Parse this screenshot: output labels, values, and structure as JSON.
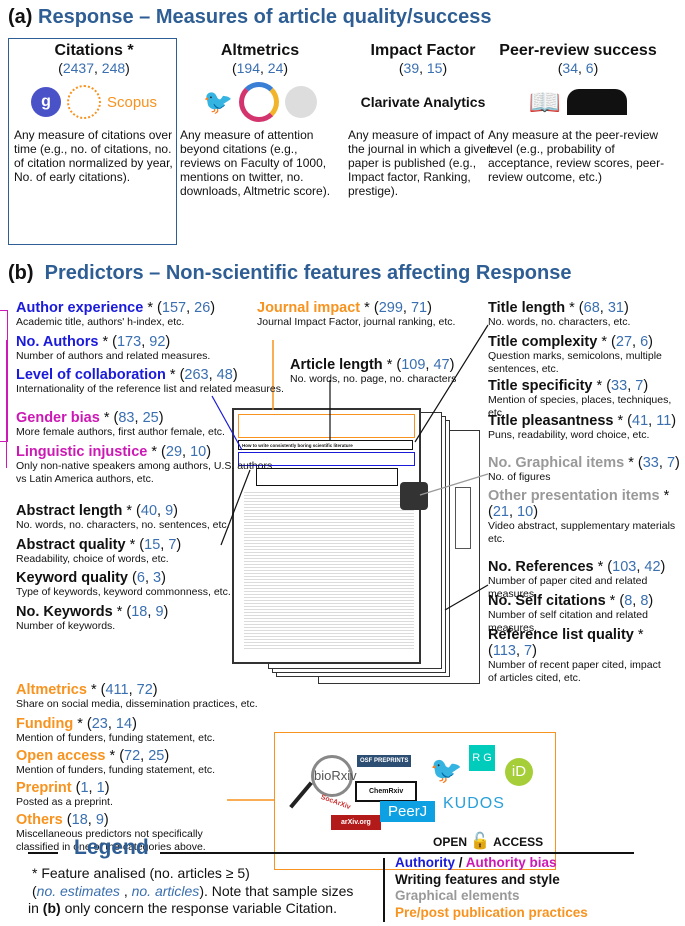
{
  "section_a": {
    "label": "(a)",
    "title": "Response – Measures of article quality/success"
  },
  "responses": [
    {
      "title": "Citations *",
      "estimates": "2437",
      "articles": "248",
      "desc": "Any measure of citations over time (e.g., no. of citations, no. of citation normalized by year, No. of early citations).",
      "logos": [
        "google-scholar",
        "web-of-science",
        "Scopus"
      ]
    },
    {
      "title": "Altmetrics",
      "estimates": "194",
      "articles": "24",
      "desc": "Any measure of attention beyond citations (e.g., reviews on Faculty of 1000, mentions on twitter, no. downloads, Altmetric score).",
      "logos": [
        "twitter",
        "altmetric-1475",
        "wikipedia"
      ]
    },
    {
      "title": "Impact Factor",
      "estimates": "39",
      "articles": "15",
      "desc": "Any measure of impact of the journal in which a given paper is published (e.g., Impact factor, Ranking, prestige).",
      "logos": [
        "Clarivate Analytics"
      ]
    },
    {
      "title": "Peer-review success",
      "estimates": "34",
      "articles": "6",
      "desc": "Any measure at the peer-review level (e.g., probability of acceptance, review scores, peer-review outcome, etc.)",
      "logos": [
        "book",
        "people"
      ]
    }
  ],
  "section_b": {
    "label": "(b)",
    "title": "Predictors – Non-scientific features affecting Response"
  },
  "colors": {
    "authority": "#1a1adb",
    "authority_bias": "#cc18b4",
    "writing": "#111111",
    "graphical": "#999999",
    "practices": "#f7931e",
    "numbers": "#3a6fb0"
  },
  "predictors": [
    {
      "name": "Author experience",
      "star": "*",
      "estimates": "157",
      "articles": "26",
      "desc": "Academic title, authors' h-index, etc.",
      "cat": "authority"
    },
    {
      "name": "No. Authors",
      "star": "*",
      "estimates": "173",
      "articles": "92",
      "desc": "Number of authors and related measures.",
      "cat": "authority"
    },
    {
      "name": "Level of collaboration",
      "star": "*",
      "estimates": "263",
      "articles": "48",
      "desc": "Internationality of the reference list and related measures.",
      "cat": "authority"
    },
    {
      "name": "Gender bias",
      "star": "*",
      "estimates": "83",
      "articles": "25",
      "desc": "More female authors, first author female, etc.",
      "cat": "authority_bias"
    },
    {
      "name": "Linguistic injustice",
      "star": "*",
      "estimates": "29",
      "articles": "10",
      "desc": "Only non-native speakers among authors, U.S. authors vs Latin America authors, etc.",
      "cat": "authority_bias"
    },
    {
      "name": "Abstract length",
      "star": "*",
      "estimates": "40",
      "articles": "9",
      "desc": "No. words, no. characters, no. sentences, etc.",
      "cat": "writing"
    },
    {
      "name": "Abstract quality",
      "star": "*",
      "estimates": "15",
      "articles": "7",
      "desc": "Readability, choice of words, etc.",
      "cat": "writing"
    },
    {
      "name": "Keyword quality",
      "star": "",
      "estimates": "6",
      "articles": "3",
      "desc": "Type of keywords, keyword commonness, etc.",
      "cat": "writing"
    },
    {
      "name": "No. Keywords",
      "star": "*",
      "estimates": "18",
      "articles": "9",
      "desc": "Number of keywords.",
      "cat": "writing"
    },
    {
      "name": "Altmetrics",
      "star": "*",
      "estimates": "411",
      "articles": "72",
      "desc": "Share on social media, dissemination practices, etc.",
      "cat": "practices"
    },
    {
      "name": "Funding",
      "star": "*",
      "estimates": "23",
      "articles": "14",
      "desc": "Mention of funders, funding statement, etc.",
      "cat": "practices"
    },
    {
      "name": "Open access",
      "star": "*",
      "estimates": "72",
      "articles": "25",
      "desc": "Mention of funders, funding statement, etc.",
      "cat": "practices"
    },
    {
      "name": "Preprint",
      "star": "",
      "estimates": "1",
      "articles": "1",
      "desc": "Posted as a preprint.",
      "cat": "practices"
    },
    {
      "name": "Others",
      "star": "",
      "estimates": "18",
      "articles": "9",
      "desc": "Miscellaneous predictors not specifically classified in one of the categories above.",
      "cat": "practices"
    },
    {
      "name": "Journal impact",
      "star": "*",
      "estimates": "299",
      "articles": "71",
      "desc": "Journal Impact Factor, journal ranking, etc.",
      "cat": "practices"
    },
    {
      "name": "Article length",
      "star": "*",
      "estimates": "109",
      "articles": "47",
      "desc": "No. words, no. page, no. characters",
      "cat": "writing"
    },
    {
      "name": "Title length",
      "star": "*",
      "estimates": "68",
      "articles": "31",
      "desc": "No. words, no. characters,  etc.",
      "cat": "writing"
    },
    {
      "name": "Title complexity",
      "star": "*",
      "estimates": "27",
      "articles": "6",
      "desc": "Question marks, semicolons, multiple sentences, etc.",
      "cat": "writing"
    },
    {
      "name": "Title specificity",
      "star": "*",
      "estimates": "33",
      "articles": "7",
      "desc": "Mention of species, places, techniques, etc.",
      "cat": "writing"
    },
    {
      "name": "Title pleasantness",
      "star": "*",
      "estimates": "41",
      "articles": "11",
      "desc": "Puns, readability, word choice, etc.",
      "cat": "writing"
    },
    {
      "name": "No. Graphical items",
      "star": "*",
      "estimates": "33",
      "articles": "7",
      "desc": "No. of figures",
      "cat": "graphical"
    },
    {
      "name": "Other presentation items",
      "star": "*",
      "estimates": "21",
      "articles": "10",
      "desc": "Video abstract, supplementary materials etc.",
      "cat": "graphical"
    },
    {
      "name": "No. References",
      "star": "*",
      "estimates": "103",
      "articles": "42",
      "desc": "Number of paper cited and related measures.",
      "cat": "writing"
    },
    {
      "name": "No. Self citations",
      "star": "*",
      "estimates": "8",
      "articles": "8",
      "desc": "Number of self citation and related measures.",
      "cat": "writing"
    },
    {
      "name": "Reference list quality",
      "star": "*",
      "estimates": "113",
      "articles": "7",
      "desc": "Number of recent paper cited, impact of articles cited, etc.",
      "cat": "writing"
    }
  ],
  "paper": {
    "title": "How to write consistently boring scientific literature"
  },
  "practice_logos": [
    "bioRxiv",
    "OSF PREPRINTS",
    "ChemRxiv",
    "SocArXiv",
    "arXiv.org",
    "PeerJ",
    "twitter",
    "R G",
    "iD",
    "KUDOS",
    "OPEN",
    "ACCESS"
  ],
  "legend": {
    "title": "Legend",
    "line1": "* Feature analised (no. articles ≥ 5)",
    "no_estimates": "no. estimates",
    "no_articles": "no. articles",
    "line2_rest": "). Note that sample sizes",
    "line3_pre": "in ",
    "line3_bold": "(b)",
    "line3_rest": " only concern the response variable Citation.",
    "authority": "Authority",
    "sep": " / ",
    "authority_bias": "Authority bias",
    "writing": "Writing features and style",
    "graphical": "Graphical elements",
    "practices": "Pre/post publication practices"
  }
}
